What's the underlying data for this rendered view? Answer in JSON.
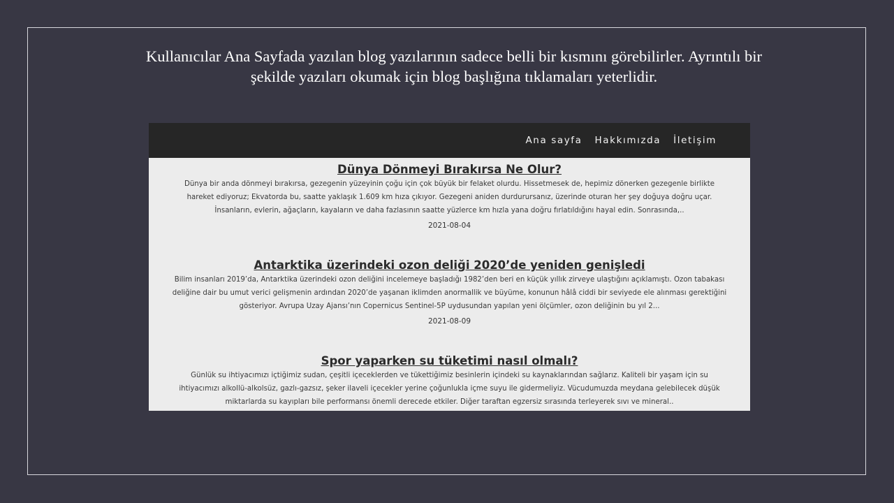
{
  "caption": {
    "line1": "Kullanıcılar Ana Sayfada yazılan blog yazılarının sadece belli bir kısmını görebilirler. Ayrıntılı bir",
    "line2": "şekilde yazıları okumak için blog başlığına tıklamaları yeterlidir."
  },
  "nav": {
    "items": [
      "Ana sayfa",
      "Hakkımızda",
      "İletişim"
    ]
  },
  "posts": [
    {
      "title": "Dünya Dönmeyi Bırakırsa Ne Olur?",
      "excerpt": "Dünya bir anda dönmeyi bırakırsa, gezegenin yüzeyinin çoğu için çok büyük bir felaket olurdu. Hissetmesek de, hepimiz dönerken gezegenle birlikte hareket ediyoruz; Ekvatorda bu, saatte yaklaşık 1.609 km hıza çıkıyor. Gezegeni aniden durdurursanız, üzerinde oturan her şey doğuya doğru uçar. İnsanların, evlerin, ağaçların, kayaların ve daha fazlasının saatte yüzlerce km hızla yana doğru fırlatıldığını hayal edin. Sonrasında,..",
      "date": "2021-08-04"
    },
    {
      "title": "Antarktika üzerindeki ozon deliği 2020’de yeniden genişledi",
      "excerpt": "Bilim insanları 2019’da, Antarktika üzerindeki ozon deliğini incelemeye başladığı 1982’den beri en küçük yıllık zirveye ulaştığını açıklamıştı. Ozon tabakası deliğine dair bu umut verici gelişmenin ardından 2020’de yaşanan iklimden anormallik ve büyüme, konunun hâlâ ciddi bir seviyede ele alınması gerektiğini gösteriyor. Avrupa Uzay Ajansı’nın Copernicus Sentinel-5P uydusundan yapılan yeni ölçümler, ozon deliğinin bu yıl 2...",
      "date": "2021-08-09"
    },
    {
      "title": "Spor yaparken su tüketimi nasıl olmalı?",
      "excerpt": "Günlük su ihtiyacımızı içtiğimiz sudan, çeşitli içeceklerden ve tükettiğimiz besinlerin içindeki su kaynaklarından sağlarız. Kaliteli bir yaşam için su ihtiyacımızı alkollü-alkolsüz, gazlı-gazsız, şeker ilaveli içecekler yerine çoğunlukla içme suyu ile gidermeliyiz. Vücudumuzda meydana gelebilecek düşük miktarlarda su kayıpları bile performansı önemli derecede etkiler. Diğer taraftan egzersiz sırasında terleyerek sıvı ve mineral..",
      "date": ""
    }
  ]
}
